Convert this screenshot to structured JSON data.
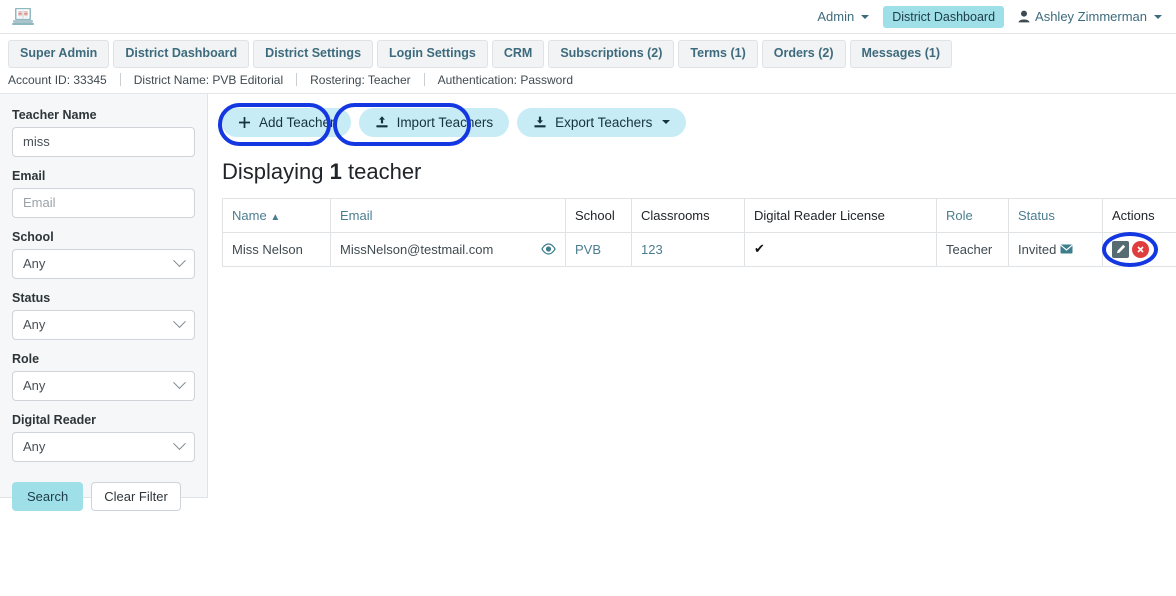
{
  "header": {
    "logo_icon": "laptop-book-logo",
    "admin_label": "Admin",
    "dashboard_badge": "District Dashboard",
    "user_name": "Ashley Zimmerman",
    "user_icon": "person-icon"
  },
  "tabs": [
    {
      "label": "Super Admin"
    },
    {
      "label": "District Dashboard"
    },
    {
      "label": "District Settings"
    },
    {
      "label": "Login Settings"
    },
    {
      "label": "CRM"
    },
    {
      "label": "Subscriptions (2)"
    },
    {
      "label": "Terms (1)"
    },
    {
      "label": "Orders (2)"
    },
    {
      "label": "Messages (1)"
    }
  ],
  "meta": {
    "account_id": "Account ID: 33345",
    "district_name": "District Name: PVB Editorial",
    "rostering": "Rostering: Teacher",
    "authentication": "Authentication: Password"
  },
  "sidebar": {
    "teacher_name_label": "Teacher Name",
    "teacher_name_value": "miss",
    "teacher_name_placeholder": "Teacher Name",
    "email_label": "Email",
    "email_value": "",
    "email_placeholder": "Email",
    "school_label": "School",
    "school_value": "Any",
    "status_label": "Status",
    "status_value": "Any",
    "role_label": "Role",
    "role_value": "Any",
    "digital_reader_label": "Digital Reader",
    "digital_reader_value": "Any",
    "search_button": "Search",
    "clear_button": "Clear Filter"
  },
  "toolbar": {
    "add_label": "Add Teacher",
    "add_icon": "plus-icon",
    "import_label": "Import Teachers",
    "import_icon": "upload-icon",
    "export_label": "Export Teachers",
    "export_icon": "download-icon"
  },
  "results": {
    "heading_prefix": "Displaying",
    "heading_count": "1",
    "heading_suffix": "teacher"
  },
  "table": {
    "columns": [
      {
        "label": "Name",
        "sorted": "▲",
        "is_link": true
      },
      {
        "label": "Email",
        "is_link": true
      },
      {
        "label": "School",
        "is_link": false
      },
      {
        "label": "Classrooms",
        "is_link": false
      },
      {
        "label": "Digital Reader License",
        "is_link": false
      },
      {
        "label": "Role",
        "is_link": true
      },
      {
        "label": "Status",
        "is_link": true
      },
      {
        "label": "Actions",
        "is_link": false
      }
    ],
    "rows": [
      {
        "name": "Miss Nelson",
        "email": "MissNelson@testmail.com",
        "email_icon": "eye-icon",
        "school": "PVB",
        "classrooms": "123",
        "digital_reader_license": "✔",
        "role": "Teacher",
        "status": "Invited",
        "status_icon": "envelope-icon",
        "actions": {
          "edit_icon": "pencil-icon",
          "delete_icon": "delete-x-icon"
        }
      }
    ]
  },
  "colors": {
    "accent_teal": "#4b7d90",
    "button_cyan": "#c8ecf5",
    "badge_cyan": "#9fdfe8",
    "annotation_blue": "#1337e0",
    "delete_red": "#e03e3e"
  }
}
